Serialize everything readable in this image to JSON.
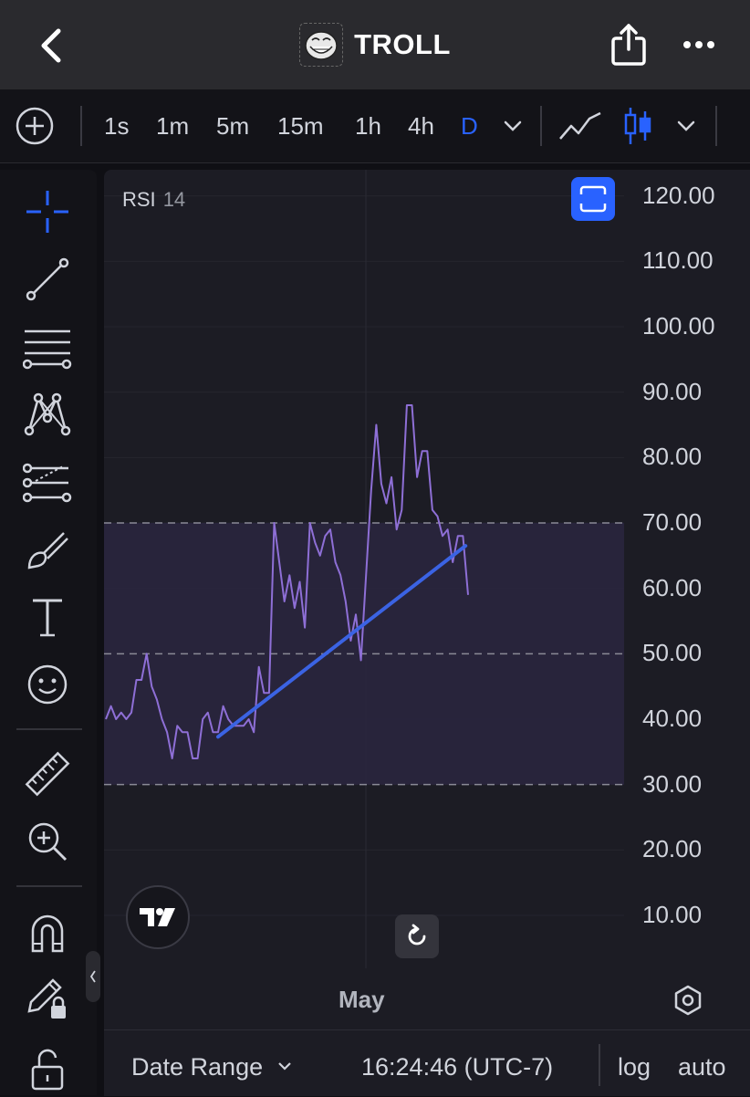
{
  "header": {
    "title": "TROLL"
  },
  "toolbar": {
    "timeframes": [
      "1s",
      "1m",
      "5m",
      "15m",
      "1h",
      "4h",
      "D"
    ],
    "active_timeframe": "D",
    "accent": "#2962ff"
  },
  "sidebar": {
    "tools": [
      "crosshair-icon",
      "trend-line-icon",
      "fib-levels-icon",
      "pattern-icon",
      "projection-icon",
      "brush-icon",
      "text-icon",
      "emoji-icon",
      "ruler-icon",
      "zoom-in-icon",
      "magnet-icon",
      "pencil-lock-icon",
      "unlock-icon"
    ]
  },
  "chart": {
    "indicator_name": "RSI",
    "indicator_length": "14",
    "x_label": "May",
    "time": "16:24:46 (UTC-7)"
  },
  "bottom": {
    "date_range": "Date Range",
    "log": "log",
    "auto": "auto"
  },
  "chart_data": {
    "type": "line",
    "series": [
      {
        "name": "RSI 14",
        "color": "#8e6fd6",
        "values": [
          40,
          42,
          40,
          41,
          40,
          41,
          46,
          46,
          50,
          45,
          43,
          40,
          38,
          34,
          39,
          38,
          38,
          34,
          34,
          40,
          41,
          38,
          38,
          42,
          40,
          39,
          39,
          39,
          40,
          38,
          48,
          44,
          44,
          70,
          64,
          58,
          62,
          57,
          61,
          54,
          70,
          67,
          65,
          68,
          69,
          64,
          62,
          58,
          52,
          56,
          49,
          62,
          75,
          85,
          76,
          73,
          77,
          69,
          72,
          88,
          88,
          77,
          81,
          81,
          72,
          71,
          68,
          69,
          64,
          68,
          68,
          59
        ],
        "x_index_range": [
          0,
          71
        ]
      }
    ],
    "trendline": {
      "color": "#3b63e3",
      "from": {
        "index": 22,
        "value": 37.3
      },
      "to": {
        "index": 70.5,
        "value": 66.5
      }
    },
    "rsi_band": {
      "lower": 30,
      "middle": 50,
      "upper": 70,
      "fill": "#2a2640"
    },
    "ylim": [
      4,
      124
    ],
    "yticks": [
      "120.00",
      "110.00",
      "100.00",
      "90.00",
      "80.00",
      "70.00",
      "60.00",
      "50.00",
      "40.00",
      "30.00",
      "20.00",
      "10.00"
    ],
    "xlabel_ticks": [
      "May"
    ],
    "grid": true
  }
}
